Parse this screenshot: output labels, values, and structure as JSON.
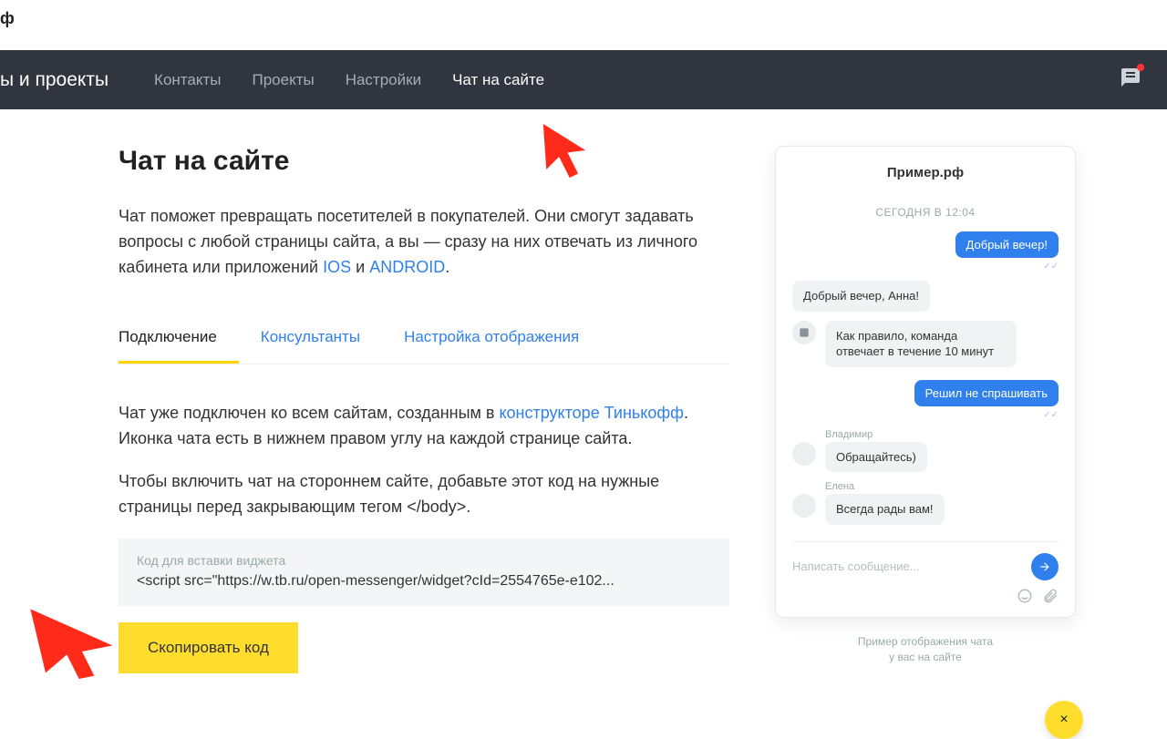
{
  "topbar_suffix": "ф",
  "nav": {
    "title": "ы и проекты",
    "items": [
      "Контакты",
      "Проекты",
      "Настройки",
      "Чат на сайте"
    ],
    "active_index": 3
  },
  "page": {
    "heading": "Чат на сайте",
    "intro_main": "Чат поможет превращать посетителей в покупателей. Они смогут задавать вопросы с любой страницы сайта, а вы — сразу на них отвечать из личного кабинета или приложений ",
    "intro_link1": "IOS",
    "intro_and": " и ",
    "intro_link2": "ANDROID",
    "intro_dot": "."
  },
  "tabs": {
    "items": [
      "Подключение",
      "Консультанты",
      "Настройка отображения"
    ],
    "active_index": 0
  },
  "body": {
    "p1_pre": "Чат уже подключен ко всем сайтам, созданным в ",
    "p1_link": "конструкторе Тинькофф",
    "p1_post": ". Иконка чата есть в нижнем правом углу на каждой странице сайта.",
    "p2": "Чтобы включить чат на стороннем сайте, добавьте этот код на нужные страницы перед закрывающим тегом </body>."
  },
  "code": {
    "label": "Код для вставки виджета",
    "content": "<script src=\"https://w.tb.ru/open-messenger/widget?cId=2554765e-e102..."
  },
  "copy_button": "Скопировать код",
  "preview": {
    "title": "Пример.рф",
    "date": "СЕГОДНЯ В 12:04",
    "msg_user1": "Добрый вечер!",
    "msg_bot1": "Добрый вечер, Анна!",
    "msg_bot2": "Как правило, команда отвечает в течение 10 минут",
    "msg_user2": "Решил не спрашивать",
    "agent1_name": "Владимир",
    "msg_agent1": "Обращайтесь)",
    "agent2_name": "Елена",
    "msg_agent2": "Всегда рады вам!",
    "input_placeholder": "Написать сообщение...",
    "caption_line1": "Пример отображения чата",
    "caption_line2": "у вас на сайте",
    "fab": "×"
  }
}
